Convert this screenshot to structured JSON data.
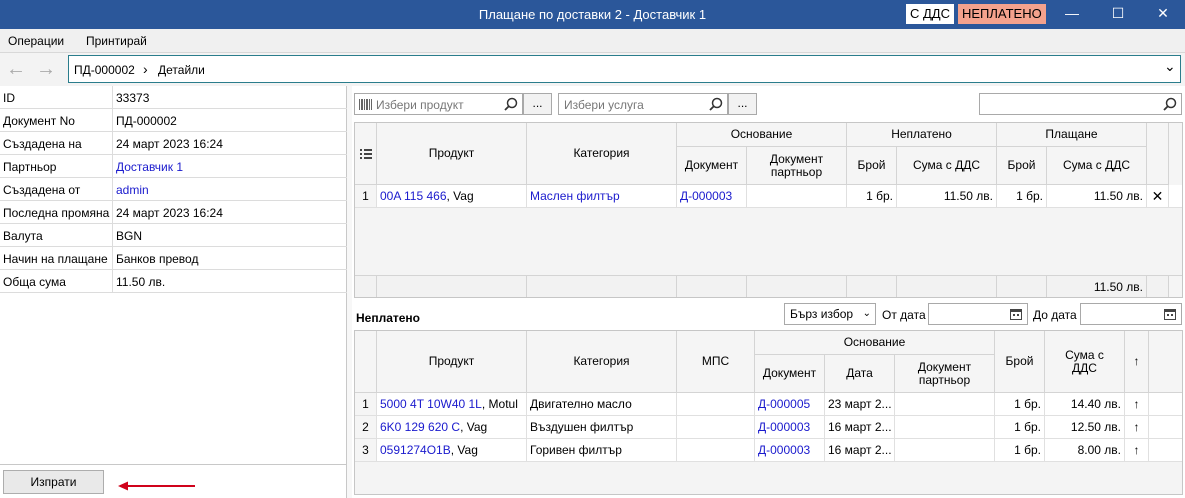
{
  "window": {
    "title": "Плащане по доставки 2 - Доставчик 1",
    "vat_badge": "С ДДС",
    "status_badge": "НЕПЛАТЕНО",
    "minimize": "—",
    "maximize": "☐",
    "close": "✕"
  },
  "menu": [
    "Операции",
    "Принтирай"
  ],
  "nav": {
    "back": "←",
    "forward": "→",
    "breadcrumb_doc": "ПД-000002",
    "breadcrumb_sep": "›",
    "breadcrumb_page": "Детайли",
    "dropdown": "⌄"
  },
  "properties": [
    {
      "label": "ID",
      "value": "33373"
    },
    {
      "label": "Документ No",
      "value": "ПД-000002"
    },
    {
      "label": "Създадена на",
      "value": "24 март 2023 16:24"
    },
    {
      "label": "Партньор",
      "value": "Доставчик 1"
    },
    {
      "label": "Създадена от",
      "value": "admin"
    },
    {
      "label": "Последна промяна",
      "value": "24 март 2023 16:24"
    },
    {
      "label": "Валута",
      "value": "BGN"
    },
    {
      "label": "Начин на плащане",
      "value": "Банков превод"
    },
    {
      "label": "Обща сума",
      "value": "11.50 лв."
    }
  ],
  "send_button": "Изпрати",
  "pickers": {
    "product_placeholder": "Избери продукт",
    "service_placeholder": "Избери услуга",
    "dots": "..."
  },
  "paid_grid": {
    "headers": {
      "product": "Продукт",
      "category": "Категория",
      "basis": "Основание",
      "document": "Документ",
      "partner_document": "Документ партньор",
      "unpaid": "Неплатено",
      "qty": "Брой",
      "amount_vat": "Сума с ДДС",
      "payment": "Плащане"
    },
    "rows": [
      {
        "n": "1",
        "product_code": "00A 115 466",
        "product_brand": ", Vag",
        "category": "Маслен филтър",
        "document": "Д-000003",
        "partner_document": "",
        "unpaid_qty": "1 бр.",
        "unpaid_amount": "11.50 лв.",
        "pay_qty": "1 бр.",
        "pay_amount": "11.50 лв.",
        "remove": "✕"
      }
    ],
    "total": "11.50 лв."
  },
  "unpaid_section": {
    "label": "Неплатено",
    "quick_select": "Бърз избор",
    "from_date": "От дата",
    "to_date": "До дата"
  },
  "unpaid_grid": {
    "headers": {
      "product": "Продукт",
      "category": "Категория",
      "mps": "МПС",
      "basis": "Основание",
      "document": "Документ",
      "date": "Дата",
      "partner_document": "Документ партньор",
      "qty": "Брой",
      "amount_vat": "Сума с ДДС",
      "move_up": "↑"
    },
    "rows": [
      {
        "n": "1",
        "product_code": "5000 4T 10W40 1L",
        "product_brand": ", Motul",
        "category": "Двигателно масло",
        "mps": "",
        "document": "Д-000005",
        "date": "23 март 2...",
        "partner_document": "",
        "qty": "1 бр.",
        "amount": "14.40 лв.",
        "up": "↑"
      },
      {
        "n": "2",
        "product_code": "6K0 129 620 C",
        "product_brand": ", Vag",
        "category": "Въздушен филтър",
        "mps": "",
        "document": "Д-000003",
        "date": "16 март 2...",
        "partner_document": "",
        "qty": "1 бр.",
        "amount": "12.50 лв.",
        "up": "↑"
      },
      {
        "n": "3",
        "product_code": "0591274O1B",
        "product_brand": ", Vag",
        "category": "Горивен филтър",
        "mps": "",
        "document": "Д-000003",
        "date": "16 март 2...",
        "partner_document": "",
        "qty": "1 бр.",
        "amount": "8.00 лв.",
        "up": "↑"
      }
    ]
  }
}
